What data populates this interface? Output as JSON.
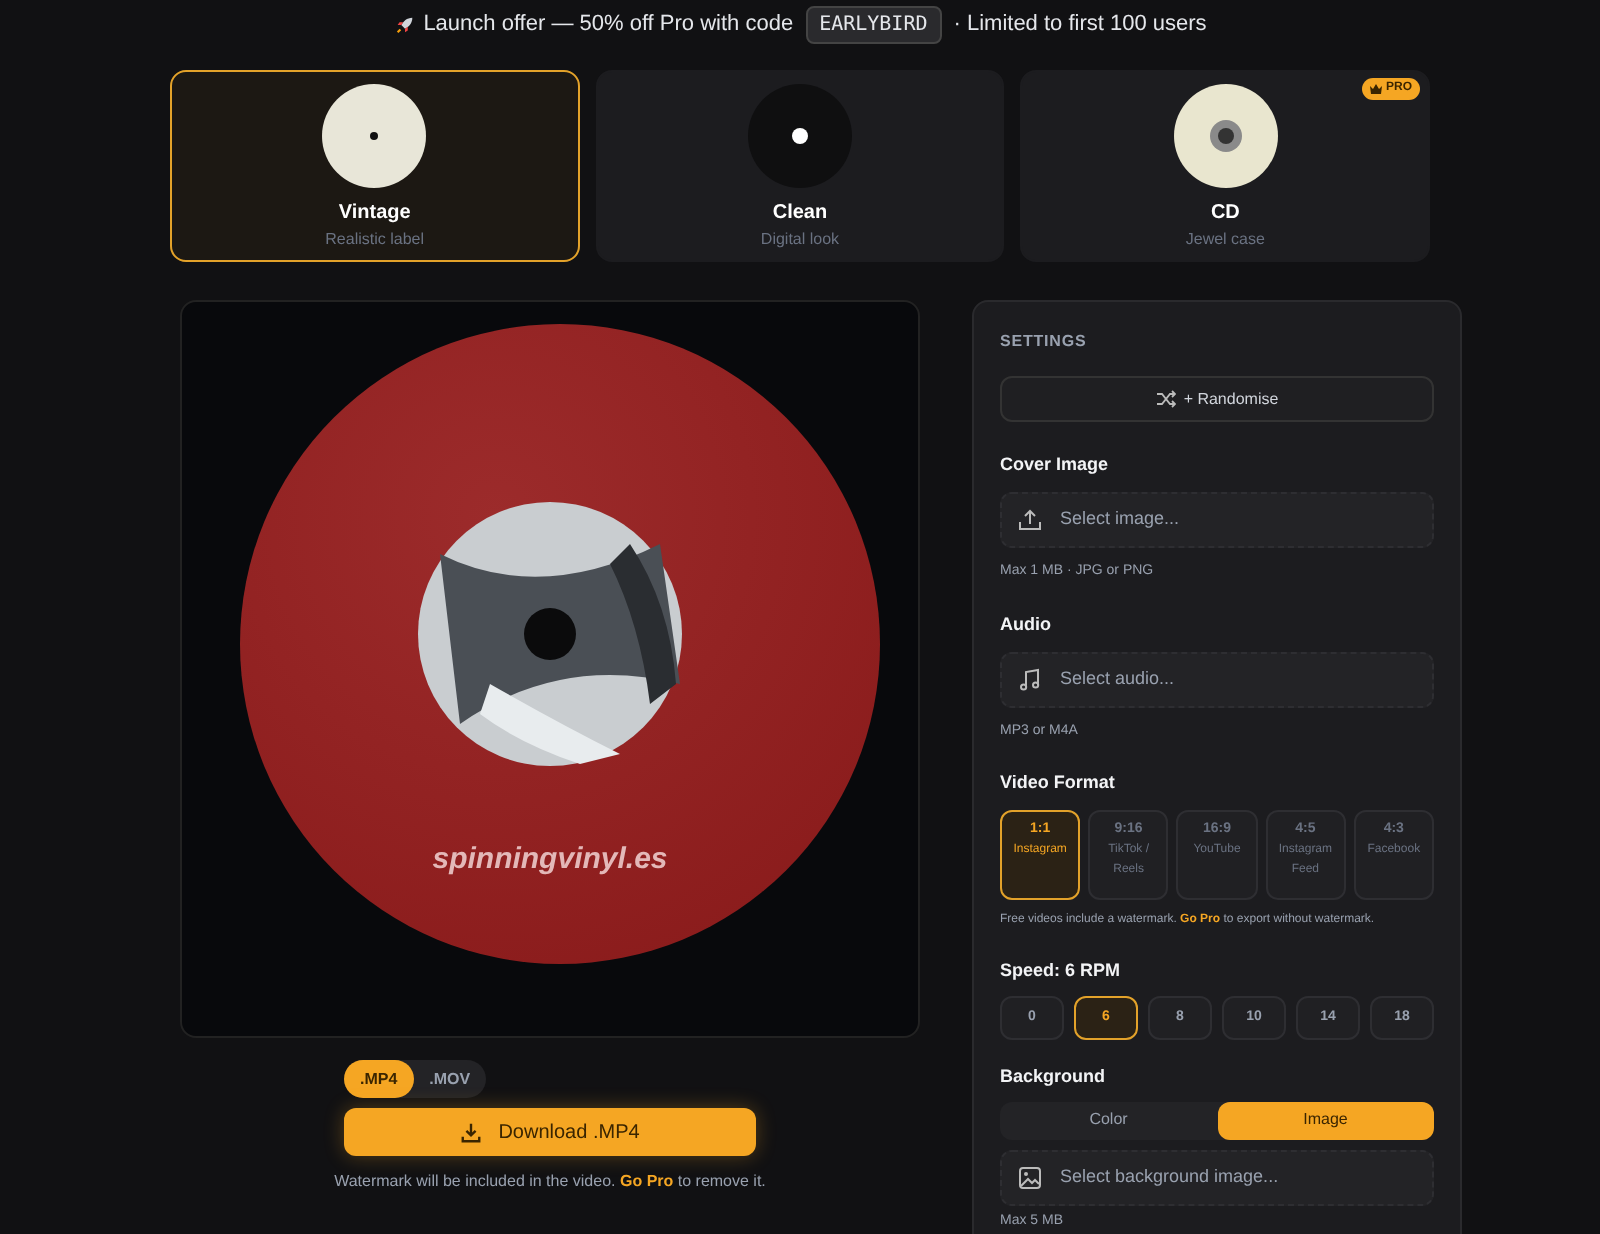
{
  "banner": {
    "text": "Launch offer — 50% off Pro with code",
    "code": "EARLYBIRD",
    "suffix": "· Limited to first 100 users"
  },
  "styles": [
    {
      "kind": "vintage",
      "title": "Vintage",
      "subtitle": "Realistic label",
      "selected": true
    },
    {
      "kind": "clean",
      "title": "Clean",
      "subtitle": "Digital look",
      "selected": false
    },
    {
      "kind": "cd",
      "title": "CD",
      "subtitle": "Jewel case",
      "selected": false,
      "badge": "PRO"
    }
  ],
  "preview": {
    "watermark": "spinningvinyl.es"
  },
  "export": {
    "formats": [
      {
        "label": ".MP4",
        "selected": true
      },
      {
        "label": ".MOV",
        "selected": false
      }
    ],
    "download": "Download .MP4",
    "note": "Watermark will be included in the video.",
    "note_link": "Go Pro",
    "note_after": "to remove it."
  },
  "settings": {
    "heading": "SETTINGS",
    "randomise": "+ Randomise",
    "cover": {
      "label": "Cover Image",
      "placeholder": "Select image...",
      "hint": "Max 1 MB · JPG or PNG"
    },
    "audio": {
      "label": "Audio",
      "placeholder": "Select audio...",
      "hint": "MP3 or M4A"
    },
    "video_format": {
      "label": "Video Format",
      "options": [
        {
          "ratio": "1:1",
          "name": "Instagram",
          "selected": true
        },
        {
          "ratio": "9:16",
          "name": "TikTok / Reels",
          "selected": false
        },
        {
          "ratio": "16:9",
          "name": "YouTube",
          "selected": false
        },
        {
          "ratio": "4:5",
          "name": "Instagram Feed",
          "selected": false
        },
        {
          "ratio": "4:3",
          "name": "Facebook",
          "selected": false
        }
      ],
      "note": "Free videos include a watermark.",
      "note_link": "Go Pro",
      "note_after": "to export without watermark."
    },
    "speed": {
      "label": "Speed: 6 RPM",
      "options": [
        {
          "label": "0",
          "selected": false
        },
        {
          "label": "6",
          "selected": true
        },
        {
          "label": "8",
          "selected": false
        },
        {
          "label": "10",
          "selected": false
        },
        {
          "label": "14",
          "selected": false
        },
        {
          "label": "18",
          "selected": false
        }
      ]
    },
    "background": {
      "label": "Background",
      "tabs": [
        {
          "label": "Color",
          "selected": false
        },
        {
          "label": "Image",
          "selected": true
        }
      ],
      "placeholder": "Select background image...",
      "hint": "Max 5 MB"
    }
  }
}
